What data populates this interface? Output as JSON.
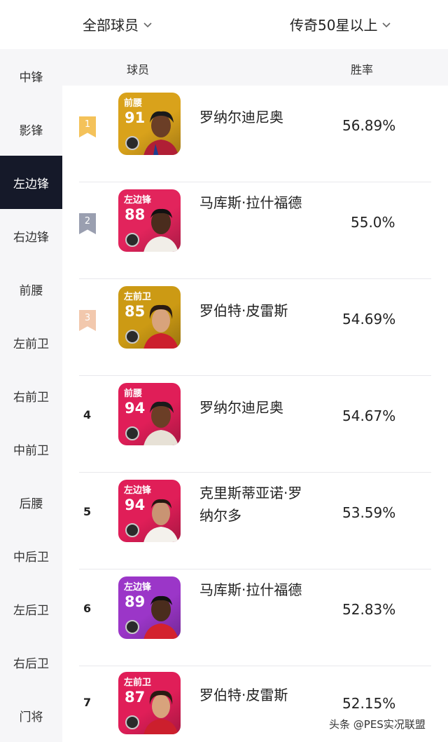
{
  "header": {
    "filter_left": "全部球员",
    "filter_right": "传奇50星以上"
  },
  "sidebar": {
    "items": [
      {
        "label": "中锋"
      },
      {
        "label": "影锋"
      },
      {
        "label": "左边锋",
        "active": true
      },
      {
        "label": "右边锋"
      },
      {
        "label": "前腰"
      },
      {
        "label": "左前卫"
      },
      {
        "label": "右前卫"
      },
      {
        "label": "中前卫"
      },
      {
        "label": "后腰"
      },
      {
        "label": "中后卫"
      },
      {
        "label": "左后卫"
      },
      {
        "label": "右后卫"
      },
      {
        "label": "门将"
      }
    ]
  },
  "table": {
    "headers": {
      "player": "球员",
      "win_rate": "胜率"
    },
    "rows": [
      {
        "rank": "1",
        "position": "前腰",
        "rating": "91",
        "name": "罗纳尔迪尼奥",
        "win_rate": "56.89%",
        "card_color": "#d9a21b",
        "badge_color": "#f4c25a"
      },
      {
        "rank": "2",
        "position": "左边锋",
        "rating": "88",
        "name": "马库斯·拉什福德",
        "win_rate": "55.0%",
        "card_color": "#e2245c",
        "badge_color": "#9a9fb0"
      },
      {
        "rank": "3",
        "position": "左前卫",
        "rating": "85",
        "name": "罗伯特·皮雷斯",
        "win_rate": "54.69%",
        "card_color": "#cc9a14",
        "badge_color": "#f2c8ad"
      },
      {
        "rank": "4",
        "position": "前腰",
        "rating": "94",
        "name": "罗纳尔迪尼奥",
        "win_rate": "54.67%",
        "card_color": "#e01e58"
      },
      {
        "rank": "5",
        "position": "左边锋",
        "rating": "94",
        "name": "克里斯蒂亚诺·罗纳尔多",
        "win_rate": "53.59%",
        "card_color": "#e01e58"
      },
      {
        "rank": "6",
        "position": "左边锋",
        "rating": "89",
        "name": "马库斯·拉什福德",
        "win_rate": "52.83%",
        "card_color": "#9b36c8"
      },
      {
        "rank": "7",
        "position": "左前卫",
        "rating": "87",
        "name": "罗伯特·皮雷斯",
        "win_rate": "52.15%",
        "card_color": "#e01e58"
      }
    ]
  },
  "watermark": "头条 @PES实况联盟"
}
